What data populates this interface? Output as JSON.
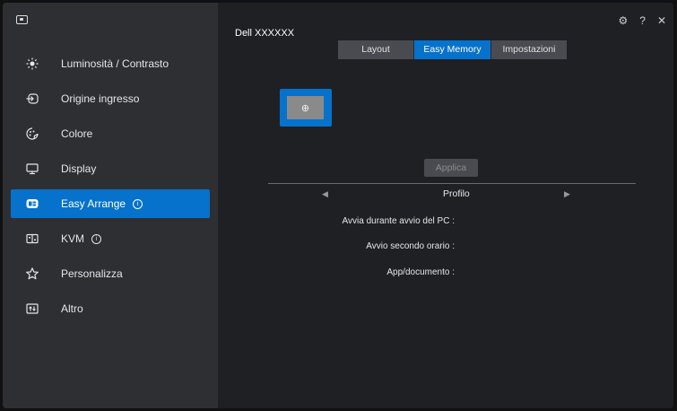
{
  "sidebar": {
    "items": [
      {
        "label": "Luminosità / Contrasto",
        "icon": "brightness-icon",
        "info": false,
        "active": false
      },
      {
        "label": "Origine ingresso",
        "icon": "input-source-icon",
        "info": false,
        "active": false
      },
      {
        "label": "Colore",
        "icon": "color-icon",
        "info": false,
        "active": false
      },
      {
        "label": "Display",
        "icon": "display-icon",
        "info": false,
        "active": false
      },
      {
        "label": "Easy Arrange",
        "icon": "easy-arrange-icon",
        "info": true,
        "active": true
      },
      {
        "label": "KVM",
        "icon": "kvm-icon",
        "info": true,
        "active": false
      },
      {
        "label": "Personalizza",
        "icon": "star-icon",
        "info": false,
        "active": false
      },
      {
        "label": "Altro",
        "icon": "others-icon",
        "info": false,
        "active": false
      }
    ]
  },
  "header": {
    "title": "Dell XXXXXX",
    "icons": [
      "gear-icon",
      "help-icon",
      "close-icon"
    ]
  },
  "tabs": [
    {
      "label": "Layout",
      "active": false
    },
    {
      "label": "Easy Memory",
      "active": true
    },
    {
      "label": "Impostazioni",
      "active": false
    }
  ],
  "main": {
    "add_layout_symbol": "⊕",
    "apply_label": "Applica",
    "profile_label": "Profilo",
    "fields": [
      "Avvia durante avvio del PC :",
      "Avvio secondo orario :",
      "App/documento :"
    ]
  },
  "colors": {
    "accent": "#0672cb",
    "sidebar_bg": "#2e2f33",
    "main_bg": "#1f2023"
  }
}
